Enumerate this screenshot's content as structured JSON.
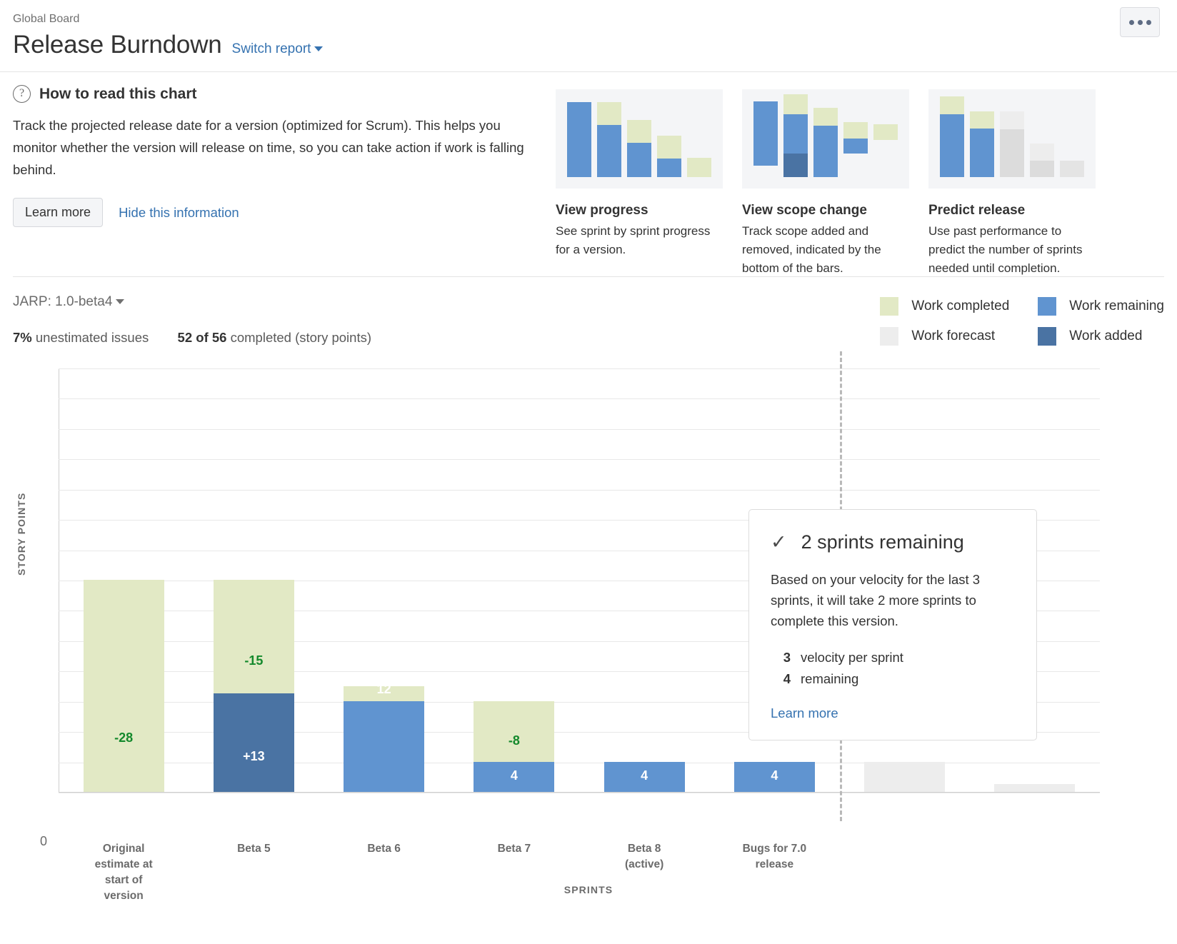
{
  "header": {
    "breadcrumb": "Global Board",
    "title": "Release Burndown",
    "switch_report": "Switch report",
    "more_menu": "•••"
  },
  "howto": {
    "icon": "question-circle-icon",
    "title": "How to read this chart",
    "body": "Track the projected release date for a version (optimized for Scrum). This helps you monitor whether the version will release on time, so you can take action if work is falling behind.",
    "learn_more": "Learn more",
    "hide": "Hide this information",
    "cards": [
      {
        "title": "View progress",
        "desc": "See sprint by sprint progress for a version."
      },
      {
        "title": "View scope change",
        "desc": "Track scope added and removed, indicated by the bottom of the bars."
      },
      {
        "title": "Predict release",
        "desc": "Use past performance to predict the number of sprints needed until completion."
      }
    ]
  },
  "controls": {
    "version": "JARP: 1.0-beta4",
    "unestimated_value": "7%",
    "unestimated_label": "unestimated issues",
    "completed_value": "52 of 56",
    "completed_label": "completed (story points)"
  },
  "legend": [
    {
      "label": "Work completed",
      "color": "#e2e9c5"
    },
    {
      "label": "Work remaining",
      "color": "#6094d0"
    },
    {
      "label": "Work forecast",
      "color": "#ededed"
    },
    {
      "label": "Work added",
      "color": "#4a73a3"
    }
  ],
  "predict": {
    "check": "✓",
    "title": "2 sprints remaining",
    "body": "Based on your velocity for the last 3 sprints, it will take 2 more sprints to complete this version.",
    "metrics": [
      {
        "value": "3",
        "label": "velocity per sprint"
      },
      {
        "value": "4",
        "label": "remaining"
      }
    ],
    "link": "Learn more"
  },
  "chart_data": {
    "type": "bar",
    "title": "Release Burndown",
    "ylabel": "STORY POINTS",
    "xlabel": "SPRINTS",
    "ylim": [
      0,
      56
    ],
    "ytick_zero": "0",
    "gridlines": 14,
    "grid": true,
    "categories": [
      "Original estimate at start of version",
      "Beta 5",
      "Beta 6",
      "Beta 7",
      "Beta 8 (active)",
      "Bugs for 7.0 release",
      "",
      ""
    ],
    "category_lines": [
      [
        "Original",
        "estimate at",
        "start of",
        "version"
      ],
      [
        "Beta 5"
      ],
      [
        "Beta 6"
      ],
      [
        "Beta 7"
      ],
      [
        "Beta 8",
        "(active)"
      ],
      [
        "Bugs for 7.0",
        "release"
      ],
      [],
      []
    ],
    "series": [
      {
        "name": "Work completed",
        "color": "#e2e9c5",
        "values": [
          28,
          15,
          2,
          8,
          0,
          0,
          0,
          0
        ]
      },
      {
        "name": "Work added",
        "color": "#4a73a3",
        "values": [
          0,
          13,
          0,
          0,
          0,
          0,
          0,
          0
        ]
      },
      {
        "name": "Work remaining",
        "color": "#6094d0",
        "values": [
          0,
          0,
          12,
          4,
          4,
          4,
          0,
          0
        ]
      },
      {
        "name": "Work forecast",
        "color": "#ededed",
        "values": [
          0,
          0,
          0,
          0,
          0,
          0,
          4,
          1
        ]
      }
    ],
    "bar_labels": [
      {
        "category": "Original estimate at start of version",
        "text": "-28",
        "style": "negative"
      },
      {
        "category": "Beta 5",
        "text": "-15",
        "style": "negative"
      },
      {
        "category": "Beta 5",
        "text": "+13",
        "style": "white"
      },
      {
        "category": "Beta 6",
        "text": "12",
        "style": "white"
      },
      {
        "category": "Beta 7",
        "text": "-8",
        "style": "negative"
      },
      {
        "category": "Beta 7",
        "text": "4",
        "style": "white"
      },
      {
        "category": "Beta 8 (active)",
        "text": "4",
        "style": "white"
      },
      {
        "category": "Bugs for 7.0 release",
        "text": "4",
        "style": "white"
      }
    ],
    "forecast_divider_after": "Bugs for 7.0 release",
    "legend_position": "top-right"
  }
}
